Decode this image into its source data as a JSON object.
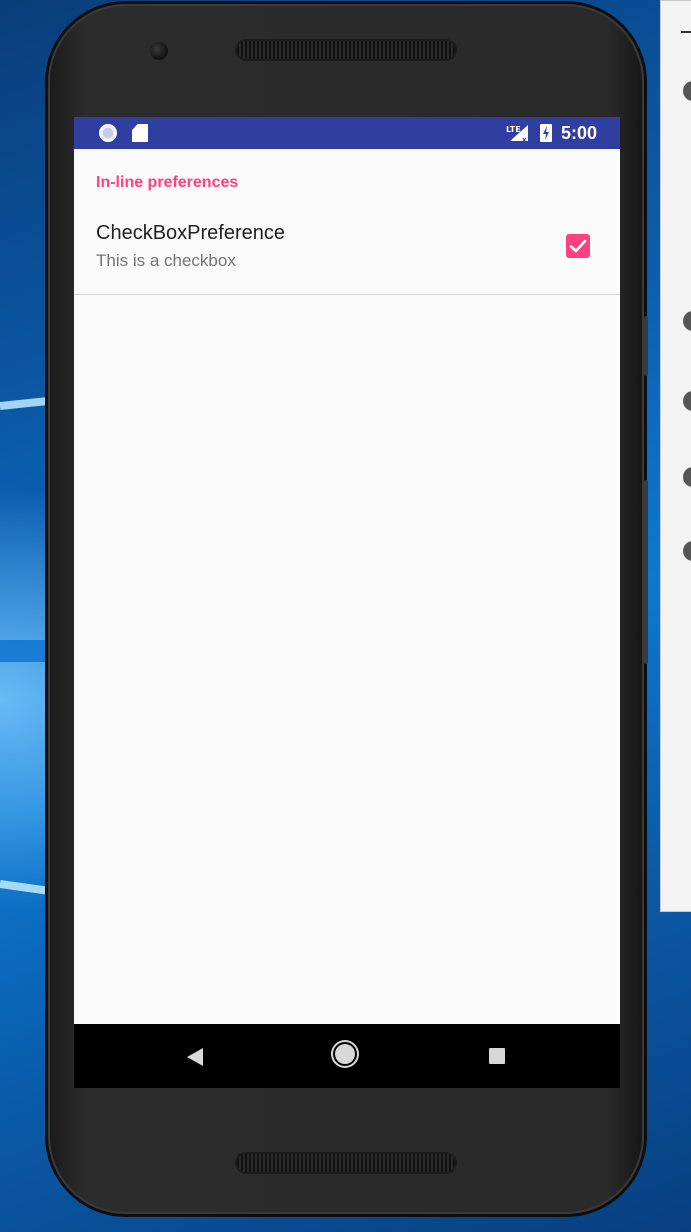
{
  "status_bar": {
    "time": "5:00",
    "network": "LTE",
    "icons": [
      "sync-icon",
      "sd-card-icon",
      "lte-signal-icon",
      "battery-charging-icon"
    ]
  },
  "preferences": {
    "category_title": "In-line preferences",
    "checkbox_preference": {
      "title": "CheckBoxPreference",
      "summary": "This is a checkbox",
      "checked": true
    }
  },
  "navigation": {
    "buttons": [
      "back-icon",
      "home-icon",
      "recents-icon"
    ]
  },
  "colors": {
    "status_bar": "#303f9f",
    "accent": "#ff4081",
    "screen_background": "#fafafa"
  }
}
